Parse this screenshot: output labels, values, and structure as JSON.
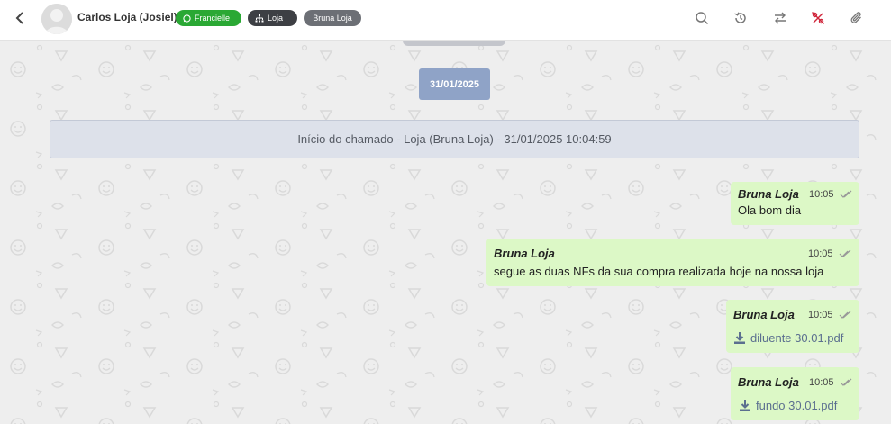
{
  "header": {
    "contact_name": "Carlos Loja (Josiel)",
    "badges": [
      {
        "label": "Francielle",
        "icon": "whatsapp-icon",
        "color": "#2aa834"
      },
      {
        "label": "Loja",
        "icon": "sitemap-icon",
        "color": "#3d3f44"
      },
      {
        "label": "Bruna Loja",
        "color": "#6c6f75"
      }
    ],
    "actions": [
      "search-icon",
      "history-icon",
      "transfer-icon",
      "percent-off-icon",
      "attachment-icon"
    ]
  },
  "chat": {
    "date_separator": "31/01/2025",
    "ticket_start": "Início do chamado - Loja (Bruna Loja) - 31/01/2025 10:04:59",
    "messages": [
      {
        "sender": "Bruna Loja",
        "time": "10:05",
        "text": "Ola bom dia"
      },
      {
        "sender": "Bruna Loja",
        "time": "10:05",
        "text": "segue as duas NFs da sua compra realizada hoje na nossa loja"
      },
      {
        "sender": "Bruna Loja",
        "time": "10:05",
        "file": "diluente 30.01.pdf"
      },
      {
        "sender": "Bruna Loja",
        "time": "10:05",
        "file": "fundo 30.01.pdf"
      }
    ]
  },
  "colors": {
    "accent_green": "#2aa834",
    "bubble": "#dcf8c6",
    "date_chip": "#8fa3c7",
    "danger_icon": "#d0263b"
  }
}
